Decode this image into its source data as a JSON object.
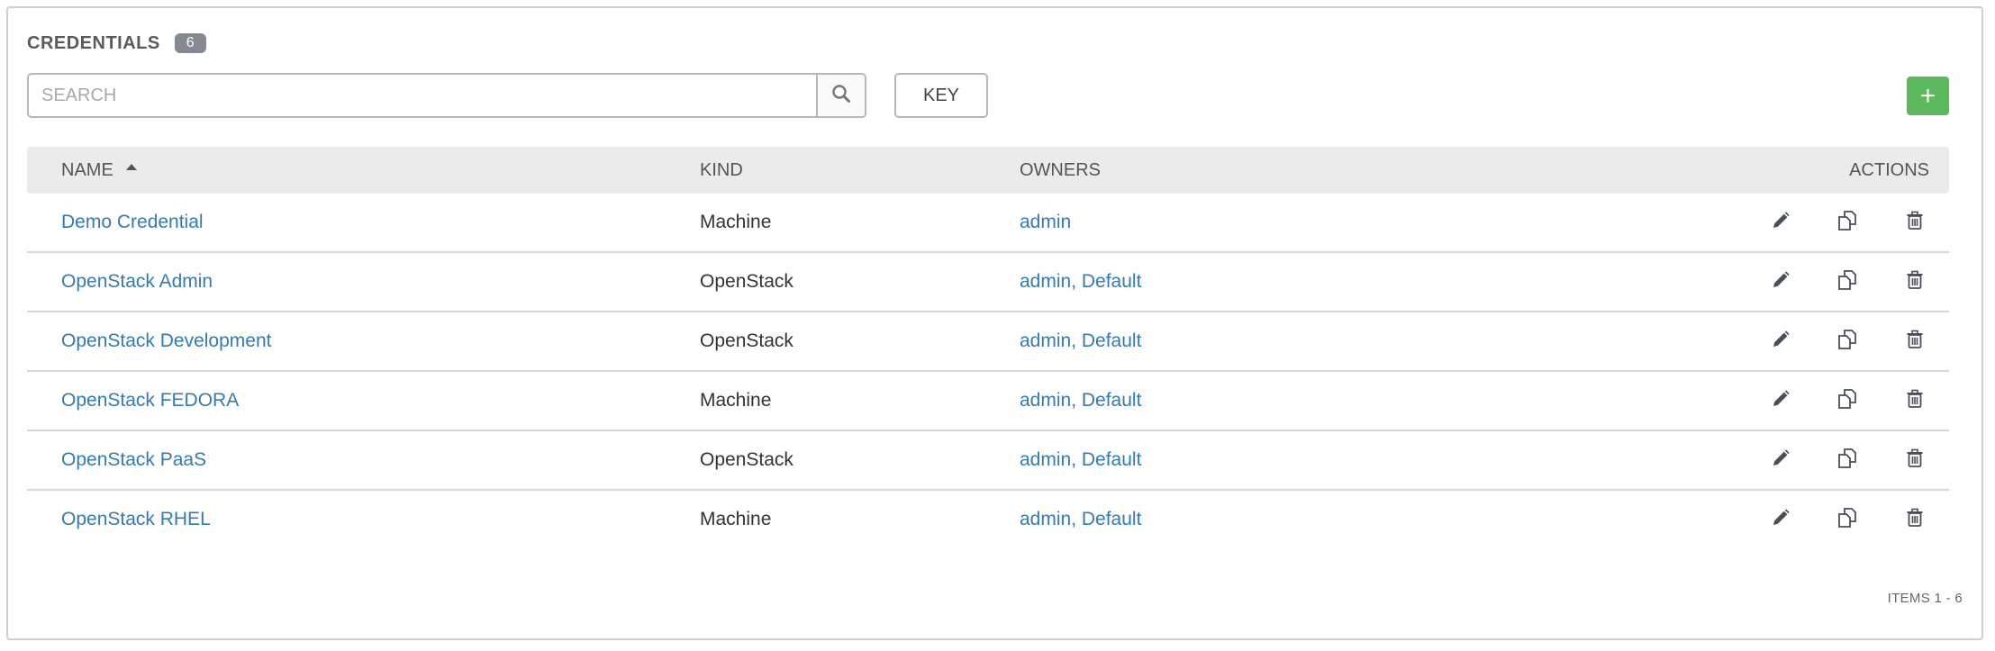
{
  "header": {
    "title": "CREDENTIALS",
    "count": "6"
  },
  "search": {
    "placeholder": "SEARCH",
    "value": ""
  },
  "toolbar": {
    "key_label": "KEY",
    "add_label": "+"
  },
  "table": {
    "columns": {
      "name": "NAME",
      "kind": "KIND",
      "owners": "OWNERS",
      "actions": "ACTIONS"
    },
    "sort": {
      "column": "name",
      "direction": "ascending"
    },
    "rows": [
      {
        "name": "Demo Credential",
        "kind": "Machine",
        "owners": [
          "admin"
        ]
      },
      {
        "name": "OpenStack Admin",
        "kind": "OpenStack",
        "owners": [
          "admin",
          "Default"
        ]
      },
      {
        "name": "OpenStack Development",
        "kind": "OpenStack",
        "owners": [
          "admin",
          "Default"
        ]
      },
      {
        "name": "OpenStack FEDORA",
        "kind": "Machine",
        "owners": [
          "admin",
          "Default"
        ]
      },
      {
        "name": "OpenStack PaaS",
        "kind": "OpenStack",
        "owners": [
          "admin",
          "Default"
        ]
      },
      {
        "name": "OpenStack RHEL",
        "kind": "Machine",
        "owners": [
          "admin",
          "Default"
        ]
      }
    ],
    "row_actions": [
      "pencil-icon",
      "copy-icon",
      "trash-icon"
    ]
  },
  "pagination": {
    "label": "ITEMS  1 - 6"
  },
  "colors": {
    "link": "#337ab7",
    "add_button": "#5cb85c",
    "badge": "#848992",
    "header_bg": "#ebebeb"
  }
}
